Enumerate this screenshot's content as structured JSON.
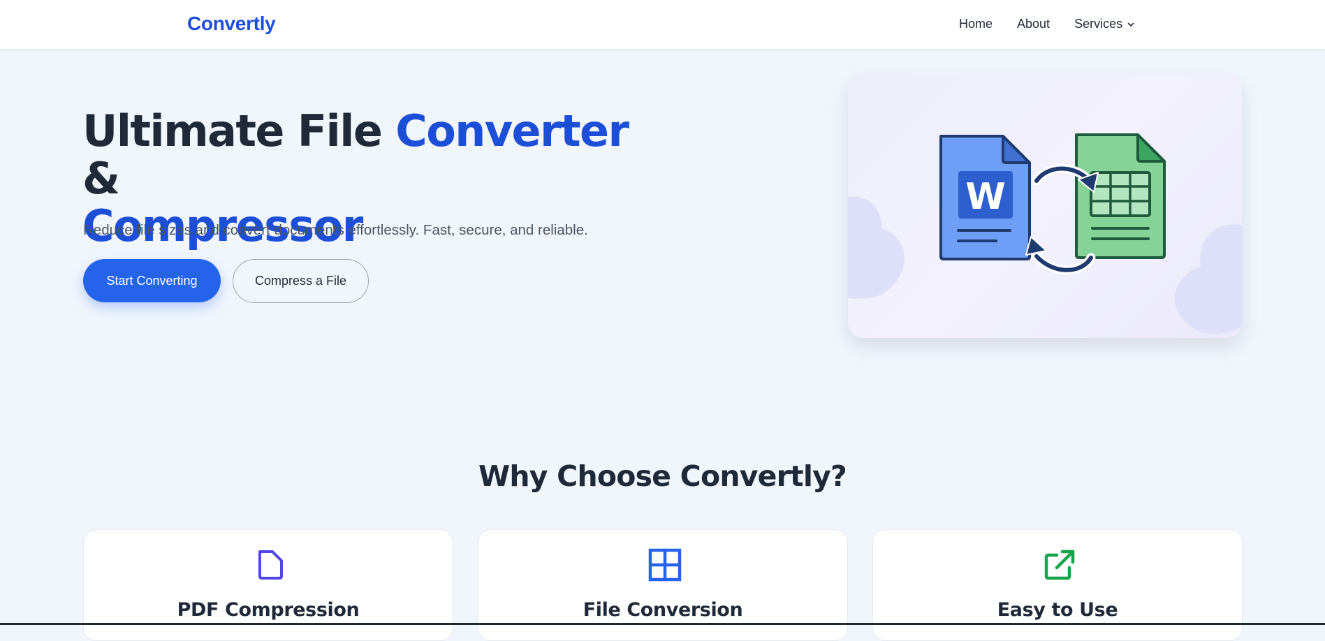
{
  "nav": {
    "logo": "Convertly",
    "links": [
      {
        "label": "Home"
      },
      {
        "label": "About"
      },
      {
        "label": "Services"
      }
    ]
  },
  "hero": {
    "title_part1": "Ultimate File ",
    "title_accent1": "Converter",
    "title_part2": " & ",
    "title_accent2": "Compressor",
    "subtitle": "Reduce file sizes and convert documents effortlessly. Fast, secure, and reliable.",
    "primary_button": "Start Converting",
    "secondary_button": "Compress a File",
    "illustration_letter": "W"
  },
  "features": {
    "heading": "Why Choose Convertly?",
    "cards": [
      {
        "title": "PDF Compression",
        "icon": "document-icon"
      },
      {
        "title": "File Conversion",
        "icon": "grid-icon"
      },
      {
        "title": "Easy to Use",
        "icon": "external-link-icon"
      }
    ]
  },
  "colors": {
    "brand": "#1d4ed8",
    "primary_button": "#2563eb",
    "page_bg": "#f1f6fd",
    "icon_purple": "#4f46e5",
    "icon_blue": "#2563eb",
    "icon_green": "#16a34a"
  }
}
